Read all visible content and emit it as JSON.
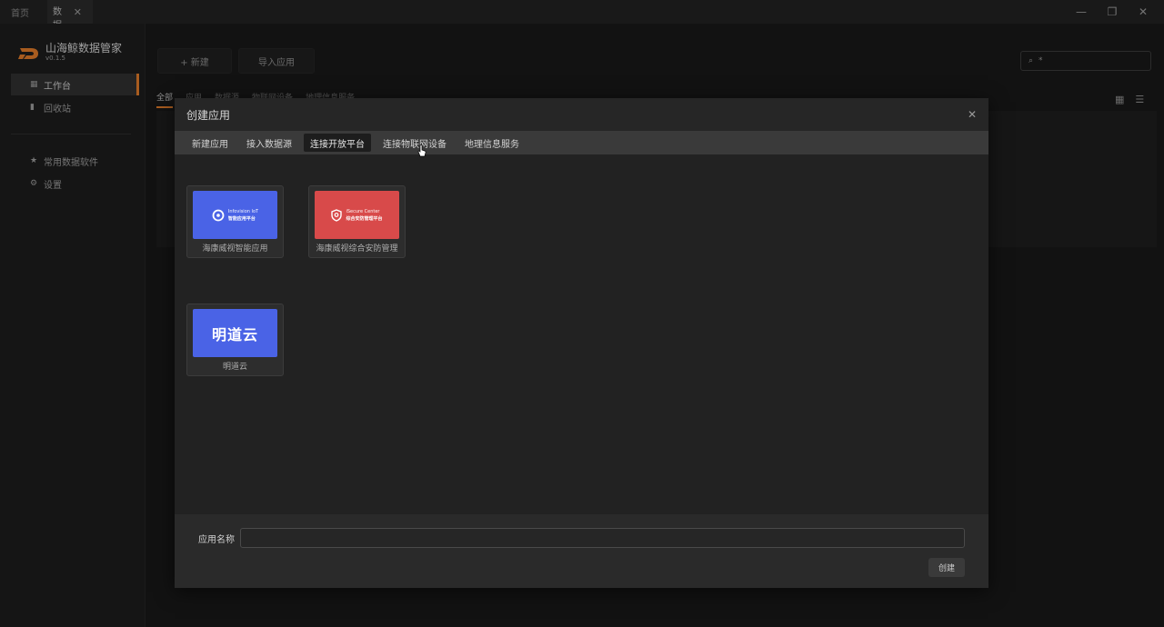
{
  "titlebar": {
    "tabs": [
      {
        "label": "首页"
      },
      {
        "label": "*数据"
      }
    ],
    "close_tab_glyph": "✕",
    "window_controls": [
      "—",
      "❐",
      "✕"
    ]
  },
  "sidebar": {
    "brand": {
      "name": "山海鲸数据管家",
      "version": "v0.1.5"
    },
    "items": [
      {
        "label": "工作台",
        "icon": "grid-icon"
      },
      {
        "label": "回收站",
        "icon": "trash-icon"
      },
      {
        "label": "常用数据软件",
        "icon": "star-icon"
      },
      {
        "label": "设置",
        "icon": "gear-icon"
      }
    ]
  },
  "main": {
    "new_button": "+ 新建",
    "import_button": "导入应用",
    "search_value": "*",
    "filters": [
      "全部",
      "应用",
      "数据源",
      "物联网设备",
      "地理信息服务"
    ]
  },
  "modal": {
    "title": "创建应用",
    "tabs": [
      "新建应用",
      "接入数据源",
      "连接开放平台",
      "连接物联网设备",
      "地理信息服务"
    ],
    "active_tab": "连接开放平台",
    "cards": [
      {
        "caption": "海康威视智能应用",
        "thumb_line1": "Infovision IoT",
        "thumb_line2": "智能应用平台",
        "color": "#4a63e6"
      },
      {
        "caption": "海康威视综合安防管理",
        "thumb_line1": "iSecure Center",
        "thumb_line2": "综合安防管理平台",
        "color": "#d84a4a"
      },
      {
        "caption": "明道云",
        "thumb_text": "明道云",
        "color": "#4a63e6"
      }
    ],
    "name_label": "应用名称",
    "name_value": "",
    "create_button": "创建"
  },
  "colors": {
    "accent": "#e07b2a",
    "brand_blue": "#4a63e6",
    "brand_red": "#d84a4a"
  }
}
